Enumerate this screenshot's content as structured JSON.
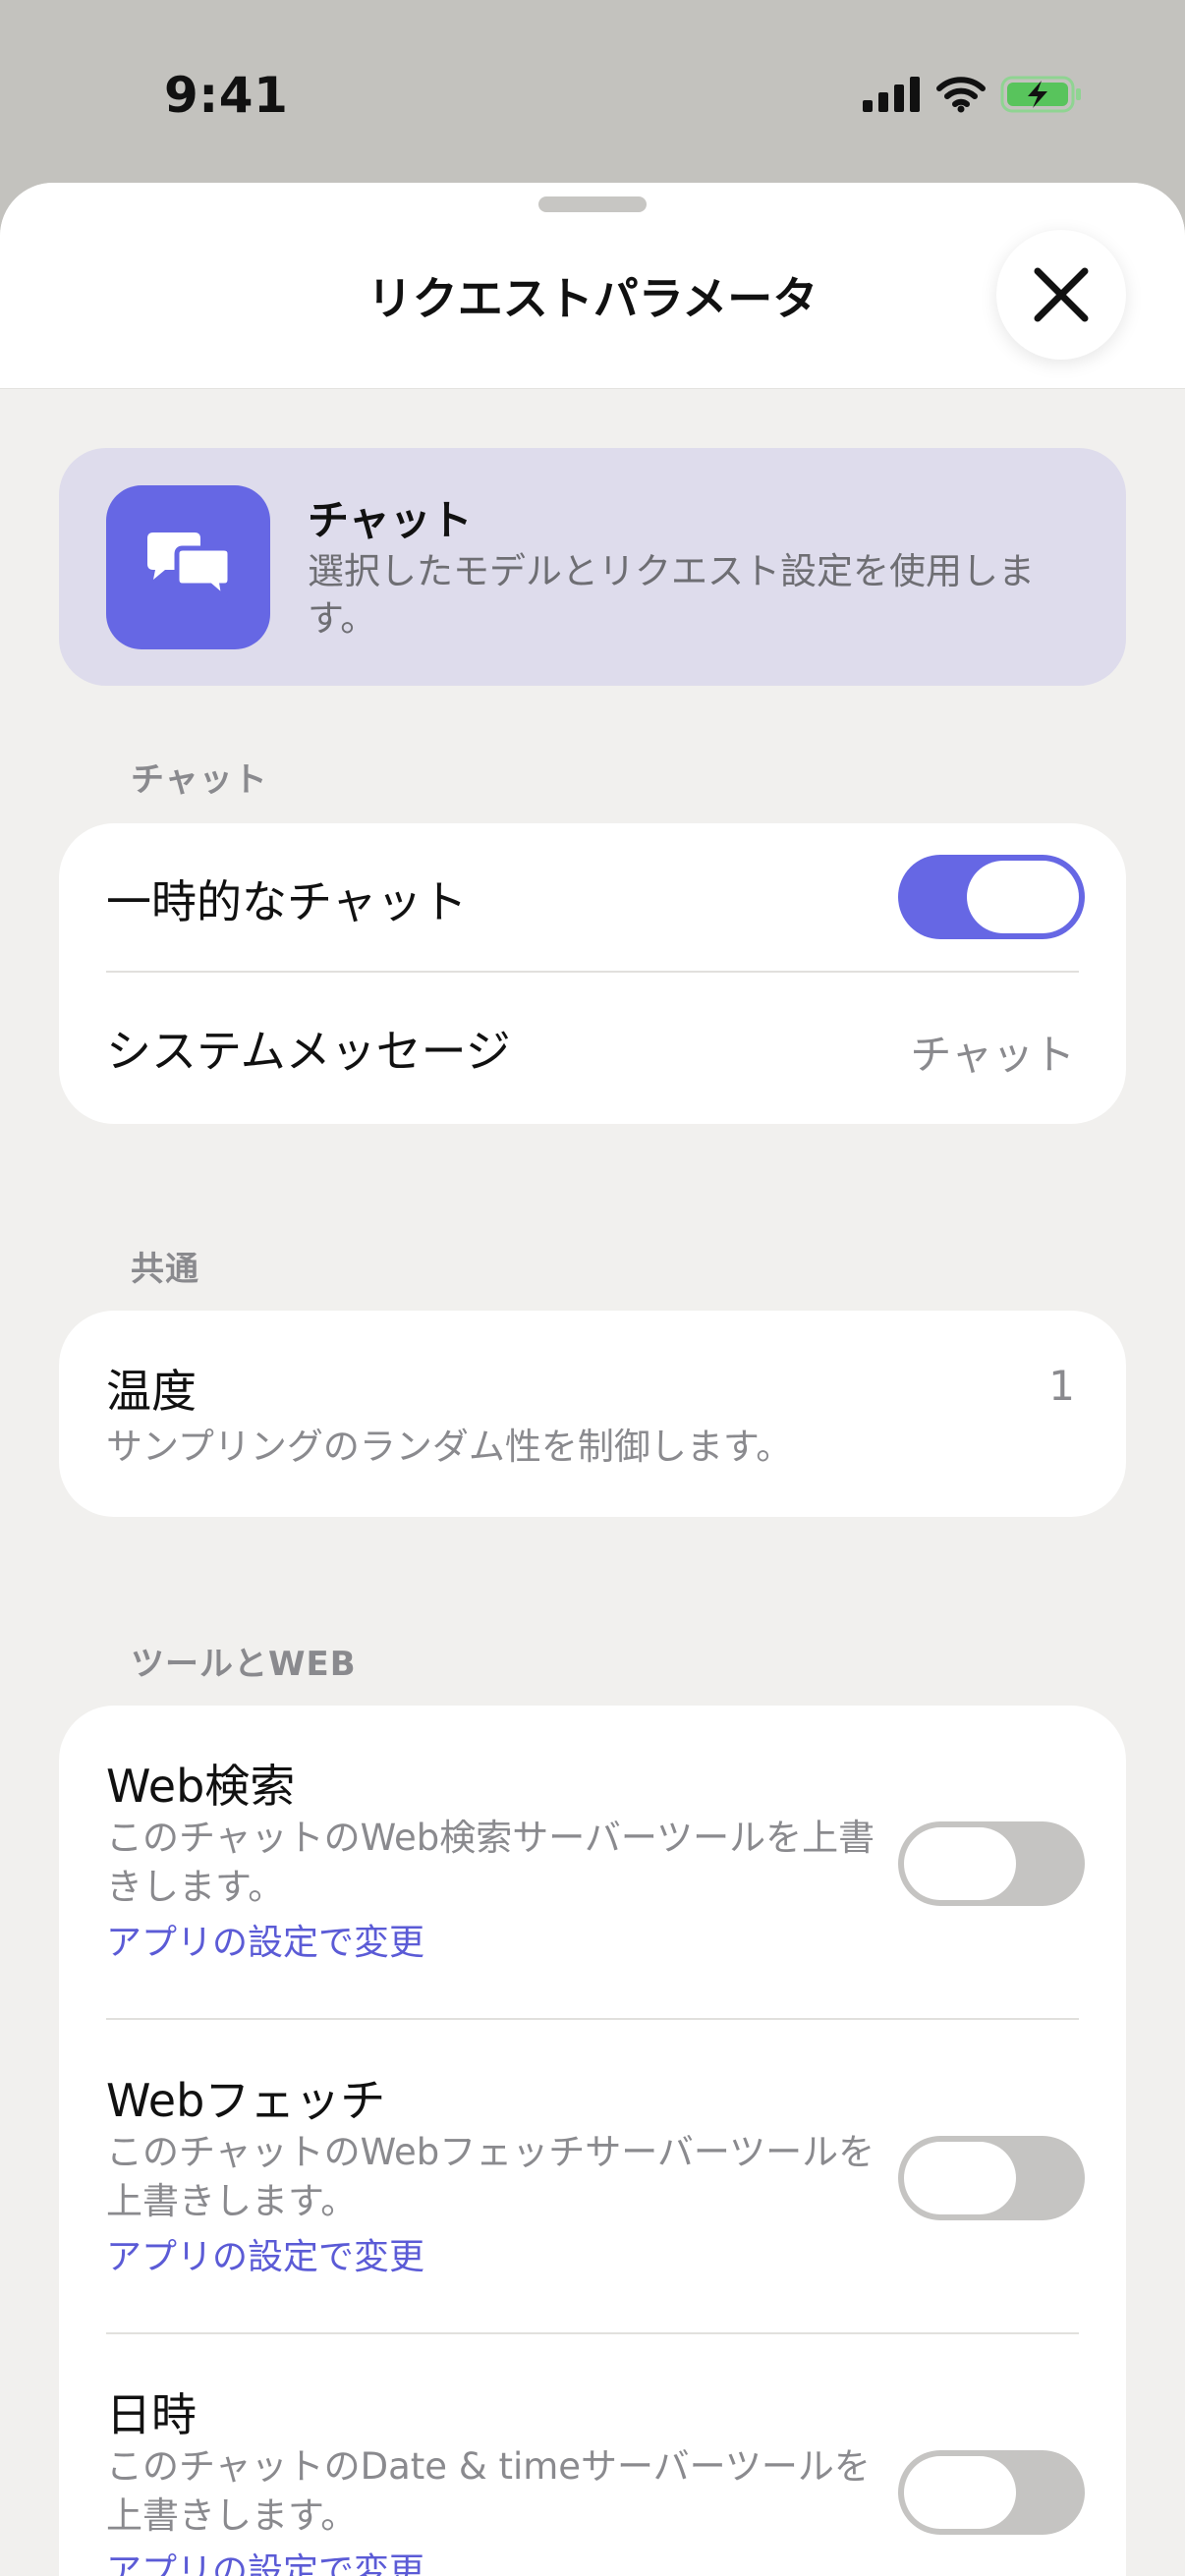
{
  "status_bar": {
    "time": "9:41"
  },
  "header": {
    "title": "リクエストパラメータ"
  },
  "banner": {
    "icon": "chat-bubbles-icon",
    "title": "チャット",
    "description": "選択したモデルとリクエスト設定を使用します。"
  },
  "sections": {
    "chat": {
      "label": "チャット",
      "temporary_chat": {
        "label": "一時的なチャット",
        "enabled": true
      },
      "system_message": {
        "label": "システムメッセージ",
        "value": "チャット"
      }
    },
    "common": {
      "label": "共通",
      "temperature": {
        "label": "温度",
        "value": "1",
        "description": "サンプリングのランダム性を制御します。"
      }
    },
    "tools": {
      "label": "ツールとWEB",
      "items": [
        {
          "label": "Web検索",
          "description": "このチャットのWeb検索サーバーツールを上書きします。",
          "link": "アプリの設定で変更",
          "enabled": false
        },
        {
          "label": "Webフェッチ",
          "description": "このチャットのWebフェッチサーバーツールを上書きします。",
          "link": "アプリの設定で変更",
          "enabled": false
        },
        {
          "label": "日時",
          "description": "このチャットのDate & timeサーバーツールを上書きします。",
          "link": "アプリの設定で変更",
          "enabled": false
        }
      ]
    }
  },
  "colors": {
    "accent": "#6667e4",
    "link": "#5b5bd6",
    "banner_bg": "#dedcec",
    "sheet_bg": "#f1f0ee"
  }
}
